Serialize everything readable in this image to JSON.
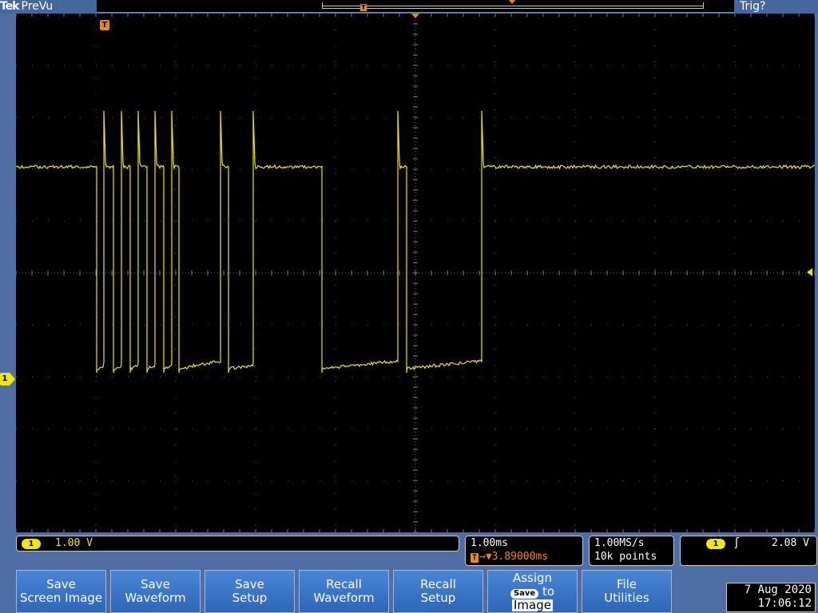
{
  "topbar": {
    "brand": "Tek",
    "mode": "PreVu",
    "trigger_status": "Trig?"
  },
  "markers": {
    "trigger_marker": "T",
    "record_trigger_marker": "T",
    "channel_marker": "1"
  },
  "channel_readout": {
    "channel": "1",
    "scale": "1.00 V"
  },
  "timebase_readout": {
    "scale": "1.00ms",
    "delay_icon": "T",
    "delay": "→▼3.89000ms"
  },
  "acquisition_readout": {
    "sample_rate": "1.00MS/s",
    "record_length": "10k points"
  },
  "trigger_readout": {
    "source": "1",
    "slope_icon": "rising-edge-icon",
    "slope_glyph": "ʃ",
    "level": "2.08 V"
  },
  "menu": {
    "buttons": [
      {
        "line1": "Save",
        "line2": "Screen Image"
      },
      {
        "line1": "Save",
        "line2": "Waveform"
      },
      {
        "line1": "Save",
        "line2": "Setup"
      },
      {
        "line1": "Recall",
        "line2": "Waveform"
      },
      {
        "line1": "Recall",
        "line2": "Setup"
      },
      {
        "line1": "Assign",
        "pill": "Save",
        "line2b": "to",
        "line3": "Image"
      },
      {
        "line1": "File",
        "line2": "Utilities"
      }
    ]
  },
  "clock": {
    "date": "7 Aug 2020",
    "time": "17:06:12"
  },
  "colors": {
    "trace": "#f0e800",
    "trigger_accent": "#f08a00",
    "menu_button": "#3a75c8",
    "background": "#4f6ea6"
  }
}
